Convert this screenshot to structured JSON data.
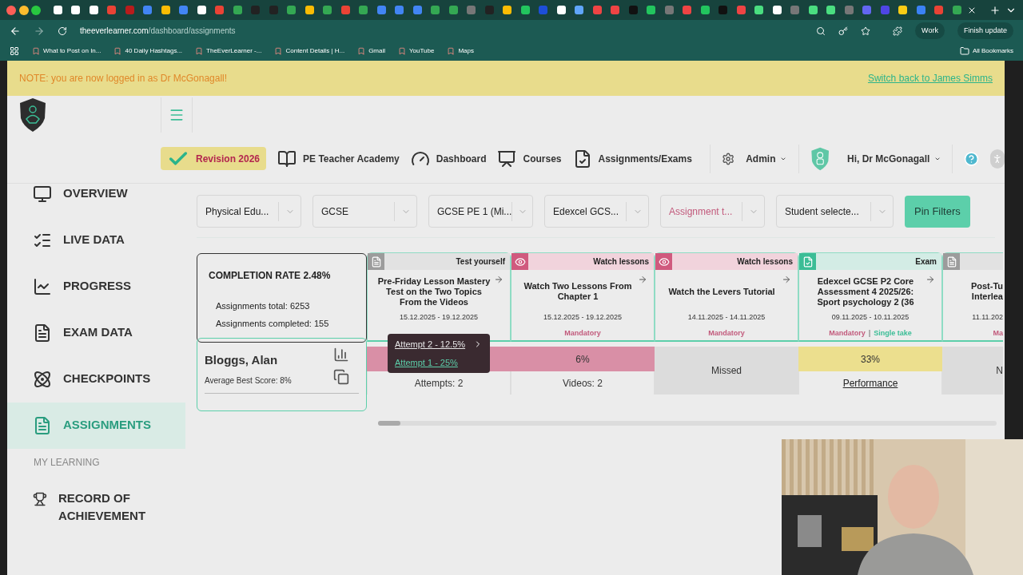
{
  "browser": {
    "url_host": "theeverlearner.com",
    "url_path": "/dashboard/assignments",
    "profile": "Work",
    "update": "Finish update",
    "bookmarks": [
      "What to Post on In...",
      "40 Daily Hashtags...",
      "TheEverLearner -...",
      "Content Details | H...",
      "Gmail",
      "YouTube",
      "Maps"
    ],
    "all_bookmarks": "All Bookmarks"
  },
  "notice": {
    "text": "NOTE: you are now logged in as Dr McGonagall!",
    "link": "Switch back to James Simms"
  },
  "nav": [
    {
      "label": "Revision 2026",
      "kind": "revision",
      "selected": true
    },
    {
      "label": "PE Teacher Academy",
      "kind": "book",
      "selected": false
    },
    {
      "label": "Dashboard",
      "kind": "gauge",
      "selected": false
    },
    {
      "label": "Courses",
      "kind": "board",
      "selected": false
    },
    {
      "label": "Assignments/Exams",
      "kind": "assign",
      "selected": false
    }
  ],
  "admin": "Admin",
  "user": "Hi, Dr McGonagall",
  "sidebar": [
    {
      "label": "OVERVIEW",
      "kind": "overview",
      "selected": false
    },
    {
      "label": "LIVE DATA",
      "kind": "live",
      "selected": false
    },
    {
      "label": "PROGRESS",
      "kind": "progress",
      "selected": false
    },
    {
      "label": "EXAM DATA",
      "kind": "exam",
      "selected": false
    },
    {
      "label": "CHECKPOINTS",
      "kind": "checkpoints",
      "selected": false
    },
    {
      "label": "ASSIGNMENTS",
      "kind": "assignments",
      "selected": true
    },
    {
      "label": "MY LEARNING",
      "kind": "heading"
    },
    {
      "label": "RECORD OF ACHIEVEMENT",
      "kind": "trophy",
      "selected": false
    }
  ],
  "filters": [
    {
      "value": "Physical Edu...",
      "placeholder": false
    },
    {
      "value": "GCSE",
      "placeholder": false
    },
    {
      "value": "GCSE PE 1 (Mi...",
      "placeholder": false
    },
    {
      "value": "Edexcel GCS...",
      "placeholder": false
    },
    {
      "value": "Assignment t...",
      "placeholder": true
    },
    {
      "value": "Student selecte...",
      "placeholder": false
    }
  ],
  "pin_button": "Pin Filters",
  "completion": {
    "title": "COMPLETION RATE 2.48%",
    "total": "Assignments total: 6253",
    "completed": "Assignments completed: 155"
  },
  "student": {
    "name": "Bloggs, Alan",
    "average": "Average Best Score: 8%"
  },
  "assignments": [
    {
      "kind": "test",
      "type": "Test yourself",
      "title": "Pre-Friday Lesson Mastery Test on the Two Topics From the Videos",
      "dates": "15.12.2025 - 19.12.2025",
      "result": {
        "color": "#d98fa6",
        "detail": "Attempts: 2",
        "detail_link": false
      }
    },
    {
      "kind": "watch",
      "type": "Watch lessons",
      "title": "Watch Two Lessons From Chapter 1",
      "dates": "15.12.2025 - 19.12.2025",
      "mandatory": "Mandatory",
      "result": {
        "color": "#d98fa6",
        "score": "6%",
        "detail": "Videos: 2",
        "detail_link": false
      }
    },
    {
      "kind": "watch",
      "type": "Watch lessons",
      "title": "Watch the Levers Tutorial",
      "dates": "14.11.2025 - 14.11.2025",
      "mandatory": "Mandatory",
      "result": {
        "color": "#dcdcdc",
        "score": "Missed"
      }
    },
    {
      "kind": "exam",
      "type": "Exam",
      "title": "Edexcel GCSE P2 Core Assessment 4 2025/26: Sport psychology 2 (36",
      "dates": "09.11.2025 - 10.11.2025",
      "mandatory": "Mandatory",
      "separator": "|",
      "single_take": "Single take",
      "result": {
        "color": "#ecdf8e",
        "score": "33%",
        "detail": "Performance",
        "detail_link": true
      }
    },
    {
      "kind": "test",
      "title": "Post-Tu Interlea",
      "dates": "11.11.202",
      "mandatory": "Ma",
      "result": {
        "color": "#dcdcdc",
        "score": "N"
      }
    }
  ],
  "tooltip": [
    {
      "label": "Attempt 2 - 12.5%",
      "selected": true
    },
    {
      "label": "Attempt 1 - 25%",
      "selected": false
    }
  ]
}
